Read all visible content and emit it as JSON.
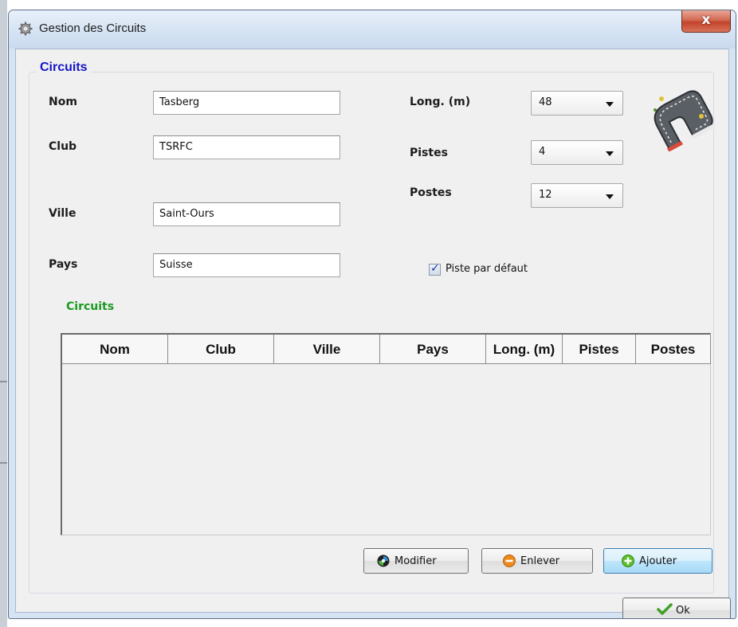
{
  "window": {
    "title": "Gestion des Circuits",
    "close_label": "x",
    "title_icon": "gear-icon"
  },
  "group": {
    "title": "Circuits"
  },
  "fields": {
    "nom": {
      "label": "Nom",
      "value": "Tasberg"
    },
    "club": {
      "label": "Club",
      "value": "TSRFC"
    },
    "ville": {
      "label": "Ville",
      "value": "Saint-Ours"
    },
    "pays": {
      "label": "Pays",
      "value": "Suisse"
    }
  },
  "combos": {
    "longueur": {
      "label": "Long. (m)",
      "value": "48"
    },
    "pistes": {
      "label": "Pistes",
      "value": "4"
    },
    "postes": {
      "label": "Postes",
      "value": "12"
    }
  },
  "checkbox": {
    "label": "Piste par défaut",
    "checked": true
  },
  "track_image": "race-track-icon",
  "table": {
    "title": "Circuits",
    "columns": [
      "Nom",
      "Club",
      "Ville",
      "Pays",
      "Long. (m)",
      "Pistes",
      "Postes"
    ],
    "rows": []
  },
  "buttons": {
    "modifier": {
      "label": "Modifier",
      "icon": "modify-icon"
    },
    "enlever": {
      "label": "Enlever",
      "icon": "remove-icon"
    },
    "ajouter": {
      "label": "Ajouter",
      "icon": "add-icon"
    },
    "ok": {
      "label": "Ok",
      "icon": "checkmark-icon"
    }
  },
  "colors": {
    "group_title": "#1515c8",
    "table_title": "#1c9a23",
    "close_button": "#c2432a"
  }
}
